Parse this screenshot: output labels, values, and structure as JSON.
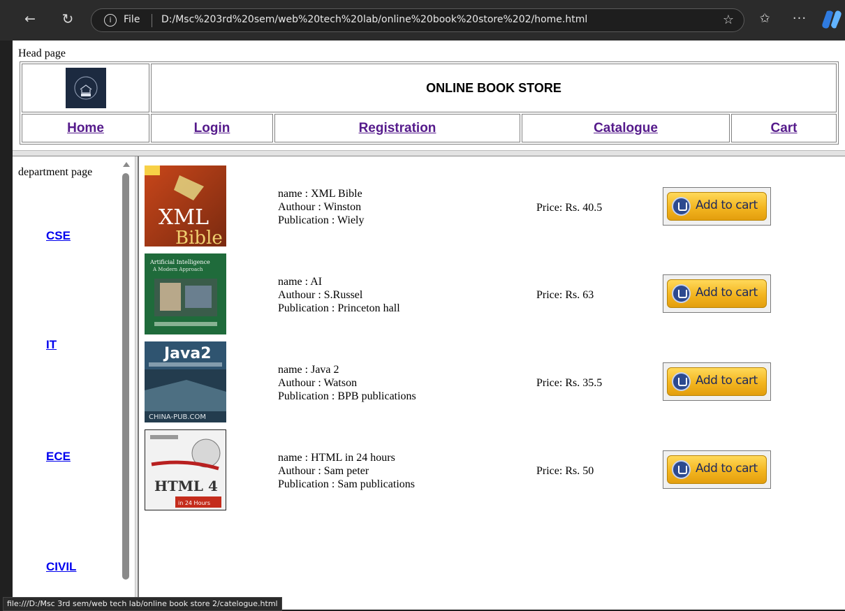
{
  "browser": {
    "file_label": "File",
    "url": "D:/Msc%203rd%20sem/web%20tech%20lab/online%20book%20store%202/home.html",
    "icons": [
      "back-icon",
      "reload-icon",
      "info-icon",
      "star-icon",
      "favorites-icon",
      "more-icon",
      "copilot-icon"
    ]
  },
  "head_frame": {
    "title": "Head page",
    "store_title": "ONLINE BOOK STORE",
    "nav": [
      "Home",
      "Login",
      "Registration",
      "Catalogue",
      "Cart"
    ]
  },
  "left_frame": {
    "title": "department page",
    "departments": [
      "CSE",
      "IT",
      "ECE",
      "CIVIL"
    ]
  },
  "books": [
    {
      "name": "name : XML Bible",
      "author": "Authour : Winston",
      "publication": "Publication : Wiely",
      "price": "Price: Rs. 40.5",
      "cart_label": "Add to cart",
      "cover": {
        "line1": "XML",
        "line2": "Bible"
      }
    },
    {
      "name": "name : AI",
      "author": "Authour : S.Russel",
      "publication": "Publication : Princeton hall",
      "price": "Price: Rs. 63",
      "cart_label": "Add to cart",
      "cover": {
        "line1": "Artificial Intelligence",
        "line2": "A Modern Approach"
      }
    },
    {
      "name": "name : Java 2",
      "author": "Authour : Watson",
      "publication": "Publication : BPB publications",
      "price": "Price: Rs. 35.5",
      "cart_label": "Add to cart",
      "cover": {
        "line1": "Java2",
        "line2": "CHINA-PUB.COM"
      }
    },
    {
      "name": "name : HTML in 24 hours",
      "author": "Authour : Sam peter",
      "publication": "Publication : Sam publications",
      "price": "Price: Rs. 50",
      "cart_label": "Add to cart",
      "cover": {
        "line1": "HTML 4",
        "line2": "in 24 Hours"
      }
    }
  ],
  "statusbar": {
    "text": "file:///D:/Msc 3rd sem/web tech lab/online book store 2/catelogue.html"
  },
  "colors": {
    "visited_link": "#551a8b",
    "link": "#0000ee",
    "chrome": "#2b2b2b"
  }
}
